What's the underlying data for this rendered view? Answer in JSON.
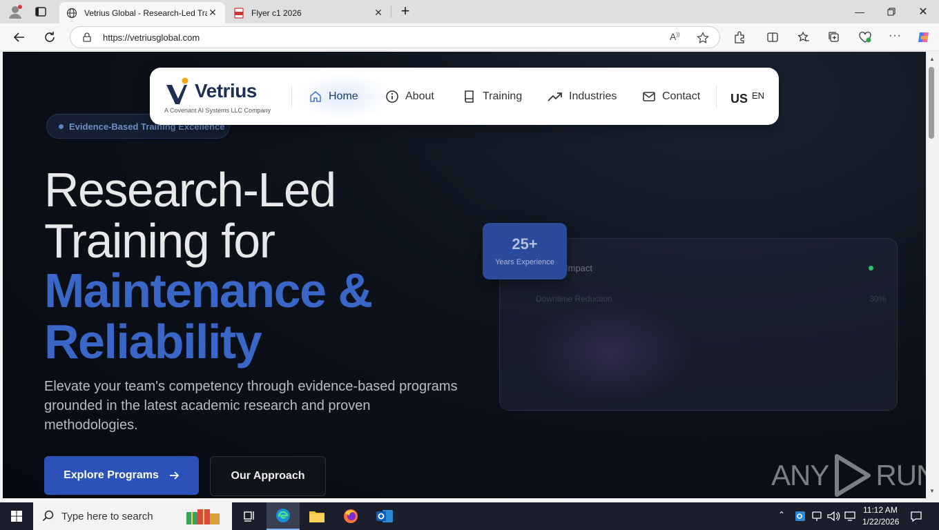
{
  "browser": {
    "tabs": [
      {
        "title": "Vetrius Global - Research-Led Tra",
        "active": true
      },
      {
        "title": "Flyer c1 2026",
        "active": false
      }
    ],
    "url": "https://vetriusglobal.com"
  },
  "site": {
    "brand": {
      "name": "Vetrius",
      "tagline": "A Covenant AI Systems LLC Company"
    },
    "nav": [
      {
        "label": "Home",
        "icon": "home-icon",
        "active": true
      },
      {
        "label": "About",
        "icon": "info-icon"
      },
      {
        "label": "Training",
        "icon": "book-icon"
      },
      {
        "label": "Industries",
        "icon": "trending-up-icon"
      },
      {
        "label": "Contact",
        "icon": "mail-icon"
      }
    ],
    "locale": {
      "flag": "US",
      "code": "EN"
    }
  },
  "hero": {
    "badge": "Evidence-Based Training Excellence",
    "title_lines": [
      "Research-Led",
      "Training for"
    ],
    "title_highlight_lines": [
      "Maintenance &",
      "Reliability"
    ],
    "subtext": "Elevate your team's competency through evidence-based programs grounded in the latest academic research and proven methodologies.",
    "cta_primary": "Explore Programs",
    "cta_secondary": "Our Approach"
  },
  "stats": {
    "experience_value": "25+",
    "experience_label": "Years Experience",
    "impact_title": "Impact",
    "impact_row_label": "Downtime Reduction",
    "impact_row_value": "30%"
  },
  "watermark": {
    "left": "ANY",
    "right": "RUN"
  },
  "taskbar": {
    "search_placeholder": "Type here to search",
    "time": "11:12 AM",
    "date": "1/22/2026"
  },
  "colors": {
    "accent_blue": "#2b52b8",
    "hero_blue": "#3a66c8",
    "brand_navy": "#1e2f52",
    "status_green": "#2fbf6a"
  }
}
